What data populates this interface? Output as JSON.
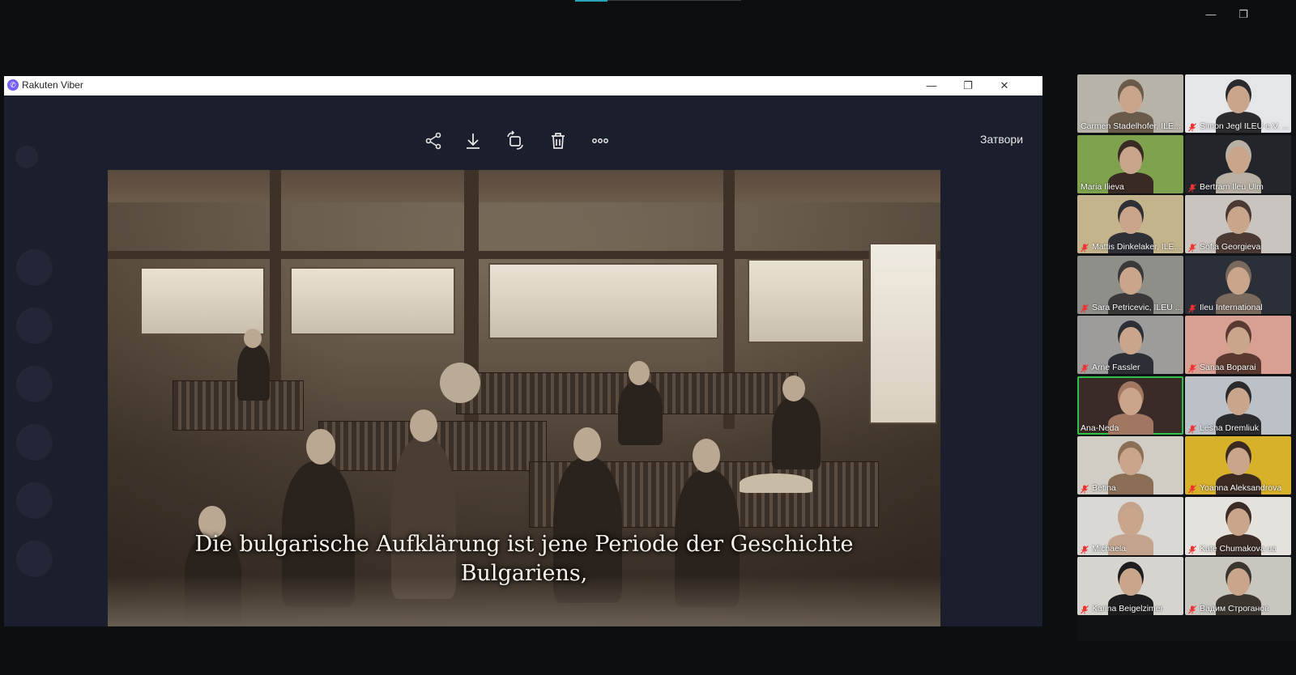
{
  "viber": {
    "app_title": "Rakuten Viber",
    "close_label": "Затвори",
    "toolbar": [
      "share-icon",
      "download-icon",
      "rotate-icon",
      "trash-icon",
      "more-icon"
    ],
    "subtitle_line1": "Die bulgarische Aufklärung ist jene Periode der Geschichte",
    "subtitle_line2": "Bulgariens,"
  },
  "participants": [
    {
      "name": "Carmen Stadelhofer, ILE...",
      "muted": false,
      "bg": "#b7b3a9",
      "fg": "#6a5a4a"
    },
    {
      "name": "Simon Jegl ILEU e.V. ...",
      "muted": true,
      "bg": "#e5e6ea",
      "fg": "#2b2b2e"
    },
    {
      "name": "Maria Ilieva",
      "muted": false,
      "bg": "#7fa24f",
      "fg": "#3a2a24"
    },
    {
      "name": "Bertram Ileu Ulm",
      "muted": true,
      "bg": "#22252a",
      "fg": "#b7b0a3"
    },
    {
      "name": "Mattis Dinkelaker, ILE...",
      "muted": true,
      "bg": "#c4b48c",
      "fg": "#2e3036"
    },
    {
      "name": "Sofia Georgieva",
      "muted": true,
      "bg": "#c9c4c0",
      "fg": "#4b3a33"
    },
    {
      "name": "Sara Petricevic, ILEU ...",
      "muted": true,
      "bg": "#8f8f8a",
      "fg": "#3a3838"
    },
    {
      "name": "Ileu International",
      "muted": true,
      "bg": "#2b2f38",
      "fg": "#7a6a5d"
    },
    {
      "name": "Arne Fassler",
      "muted": true,
      "bg": "#9d9c9b",
      "fg": "#2d2f36"
    },
    {
      "name": "Sanaa Boparai",
      "muted": true,
      "bg": "#d8a093",
      "fg": "#5a3a30"
    },
    {
      "name": "Ana-Neda",
      "muted": false,
      "bg": "#3a2a28",
      "fg": "#a27762",
      "active": true
    },
    {
      "name": "Lesha Dremliuk",
      "muted": true,
      "bg": "#bcc0c7",
      "fg": "#2b2b2d"
    },
    {
      "name": "Betina",
      "muted": true,
      "bg": "#d1ccc4",
      "fg": "#8a6e55"
    },
    {
      "name": "Yoanna Aleksandrova",
      "muted": true,
      "bg": "#d8b12a",
      "fg": "#3b2a22"
    },
    {
      "name": "Michaela",
      "muted": true,
      "bg": "#d9d8d5",
      "fg": "#c3a38c"
    },
    {
      "name": "Kate Chumakova ua",
      "muted": true,
      "bg": "#e5e1dc",
      "fg": "#3b2c26"
    },
    {
      "name": "Karina Beigelzimer",
      "muted": true,
      "bg": "#d7d4cf",
      "fg": "#1d1d1f"
    },
    {
      "name": "Вадим Строганов",
      "muted": true,
      "bg": "#c8c6bf",
      "fg": "#3a352e"
    }
  ]
}
